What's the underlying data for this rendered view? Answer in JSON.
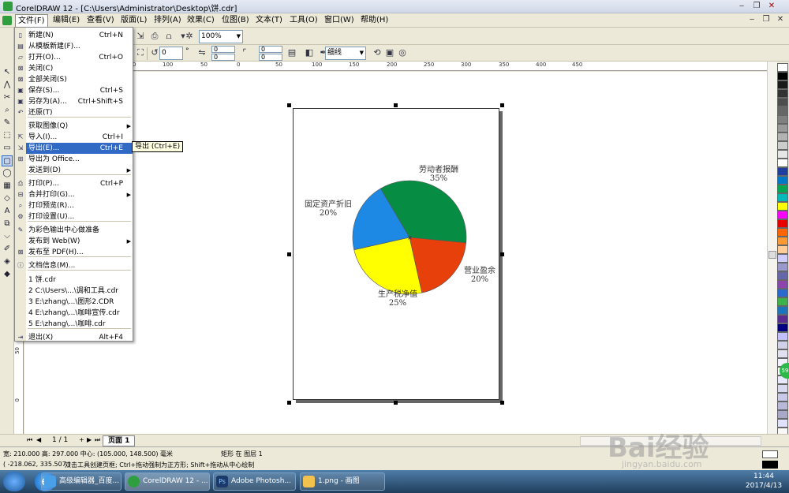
{
  "window": {
    "title": "CorelDRAW 12 - [C:\\Users\\Administrator\\Desktop\\饼.cdr]"
  },
  "menubar": [
    {
      "label": "文件(F)"
    },
    {
      "label": "编辑(E)"
    },
    {
      "label": "查看(V)"
    },
    {
      "label": "版面(L)"
    },
    {
      "label": "排列(A)"
    },
    {
      "label": "效果(C)"
    },
    {
      "label": "位图(B)"
    },
    {
      "label": "文本(T)"
    },
    {
      "label": "工具(O)"
    },
    {
      "label": "窗口(W)"
    },
    {
      "label": "帮助(H)"
    }
  ],
  "toolbar": {
    "zoom": "100%",
    "rotation": "0",
    "rotation_unit": "°",
    "offset_x": "0",
    "offset_y": "0",
    "corner_a": "0",
    "corner_b": "0",
    "outline_width": "细线",
    "degree_sign": "°"
  },
  "cursor_readout": {
    "x": "x:",
    "y": "y:"
  },
  "hruler_ticks": [
    "150",
    "100",
    "50",
    "0",
    "50",
    "100",
    "150",
    "200",
    "250",
    "300",
    "350",
    "400",
    "450"
  ],
  "vruler_ticks": [
    "250",
    "200",
    "150",
    "100",
    "50",
    "0"
  ],
  "file_menu": {
    "items": [
      {
        "label": "新建(N)",
        "shortcut": "Ctrl+N"
      },
      {
        "label": "从模板新建(F)...",
        "shortcut": ""
      },
      {
        "label": "打开(O)...",
        "shortcut": "Ctrl+O"
      },
      {
        "label": "关闭(C)",
        "shortcut": ""
      },
      {
        "label": "全部关闭(S)",
        "shortcut": ""
      },
      {
        "label": "保存(S)...",
        "shortcut": "Ctrl+S"
      },
      {
        "label": "另存为(A)...",
        "shortcut": "Ctrl+Shift+S"
      },
      {
        "label": "还原(T)",
        "shortcut": ""
      },
      {
        "label": "获取图像(Q)",
        "shortcut": ""
      },
      {
        "label": "导入(I)...",
        "shortcut": "Ctrl+I"
      },
      {
        "label": "导出(E)...",
        "shortcut": "Ctrl+E"
      },
      {
        "label": "导出为 Office...",
        "shortcut": ""
      },
      {
        "label": "发送到(D)",
        "shortcut": ""
      },
      {
        "label": "打印(P)...",
        "shortcut": "Ctrl+P"
      },
      {
        "label": "合并打印(G)...",
        "shortcut": ""
      },
      {
        "label": "打印预览(R)...",
        "shortcut": ""
      },
      {
        "label": "打印设置(U)...",
        "shortcut": ""
      },
      {
        "label": "为彩色输出中心做准备",
        "shortcut": ""
      },
      {
        "label": "发布到 Web(W)",
        "shortcut": ""
      },
      {
        "label": "发布至 PDF(H)...",
        "shortcut": ""
      },
      {
        "label": "文档信息(M)...",
        "shortcut": ""
      },
      {
        "label": "1 饼.cdr",
        "shortcut": ""
      },
      {
        "label": "2 C:\\Users\\...\\调和工具.cdr",
        "shortcut": ""
      },
      {
        "label": "3 E:\\zhang\\...\\图形2.CDR",
        "shortcut": ""
      },
      {
        "label": "4 E:\\zhang\\...\\咖啡宣传.cdr",
        "shortcut": ""
      },
      {
        "label": "5 E:\\zhang\\...\\咖啡.cdr",
        "shortcut": ""
      },
      {
        "label": "退出(X)",
        "shortcut": "Alt+F4"
      }
    ],
    "tooltip": "导出 (Ctrl+E)"
  },
  "chart_data": {
    "type": "pie",
    "categories": [
      "劳动者报酬",
      "营业盈余",
      "生产税净值",
      "固定资产折旧"
    ],
    "labels": [
      "35%",
      "20%",
      "25%",
      "20%"
    ],
    "values": [
      35,
      20,
      25,
      20
    ],
    "colors": [
      "#078c44",
      "#e8400a",
      "#ffff00",
      "#1e88e5"
    ]
  },
  "page_nav": {
    "counter": "1 / 1",
    "tab": "页面 1"
  },
  "status": {
    "line1_size": "宽: 210.000  高: 297.000  中心: (105.000, 148.500)  毫米",
    "line1_obj": "矩形 在 图层 1",
    "line2_coords": "( -218.062, 335.507 )",
    "line2_hint": "双击工具创建页框; Ctrl+拖动强制为正方形; Shift+拖动从中心绘制"
  },
  "taskbar": {
    "tasks": [
      {
        "label": "高级编辑器_百度..."
      },
      {
        "label": "CorelDRAW 12 - ..."
      },
      {
        "label": "Adobe Photosh..."
      },
      {
        "label": "1.png - 画图"
      }
    ],
    "time": "11:44",
    "date": "2017/4/13"
  },
  "palette_colors": [
    "#ffffff",
    "#000000",
    "#1a1a1a",
    "#333333",
    "#4d4d4d",
    "#666666",
    "#808080",
    "#999999",
    "#b3b3b3",
    "#cccccc",
    "#e6e6e6",
    "#ffffff",
    "#1e3fa0",
    "#0078c8",
    "#00a651",
    "#00b9b9",
    "#ffff00",
    "#ff00ff",
    "#e60000",
    "#ff6600",
    "#ff9933",
    "#ffcc99",
    "#ccccff",
    "#9999cc",
    "#6666aa",
    "#8e44ad",
    "#2a6ad0",
    "#3cb44b",
    "#1a75bc",
    "#5b2c8f",
    "#000080",
    "#c0c0ff",
    "#d0d0e8",
    "#e0e0f0",
    "#f0f0ff",
    "#ffffff",
    "#e8e8ff",
    "#d8d8f0",
    "#c8c8e8",
    "#b8b8d8",
    "#a8a8c8",
    "#e0e0ff",
    "#f8f8f8"
  ],
  "watermark": {
    "text": "Bai经验",
    "sub": "jingyan.baidu.com"
  }
}
